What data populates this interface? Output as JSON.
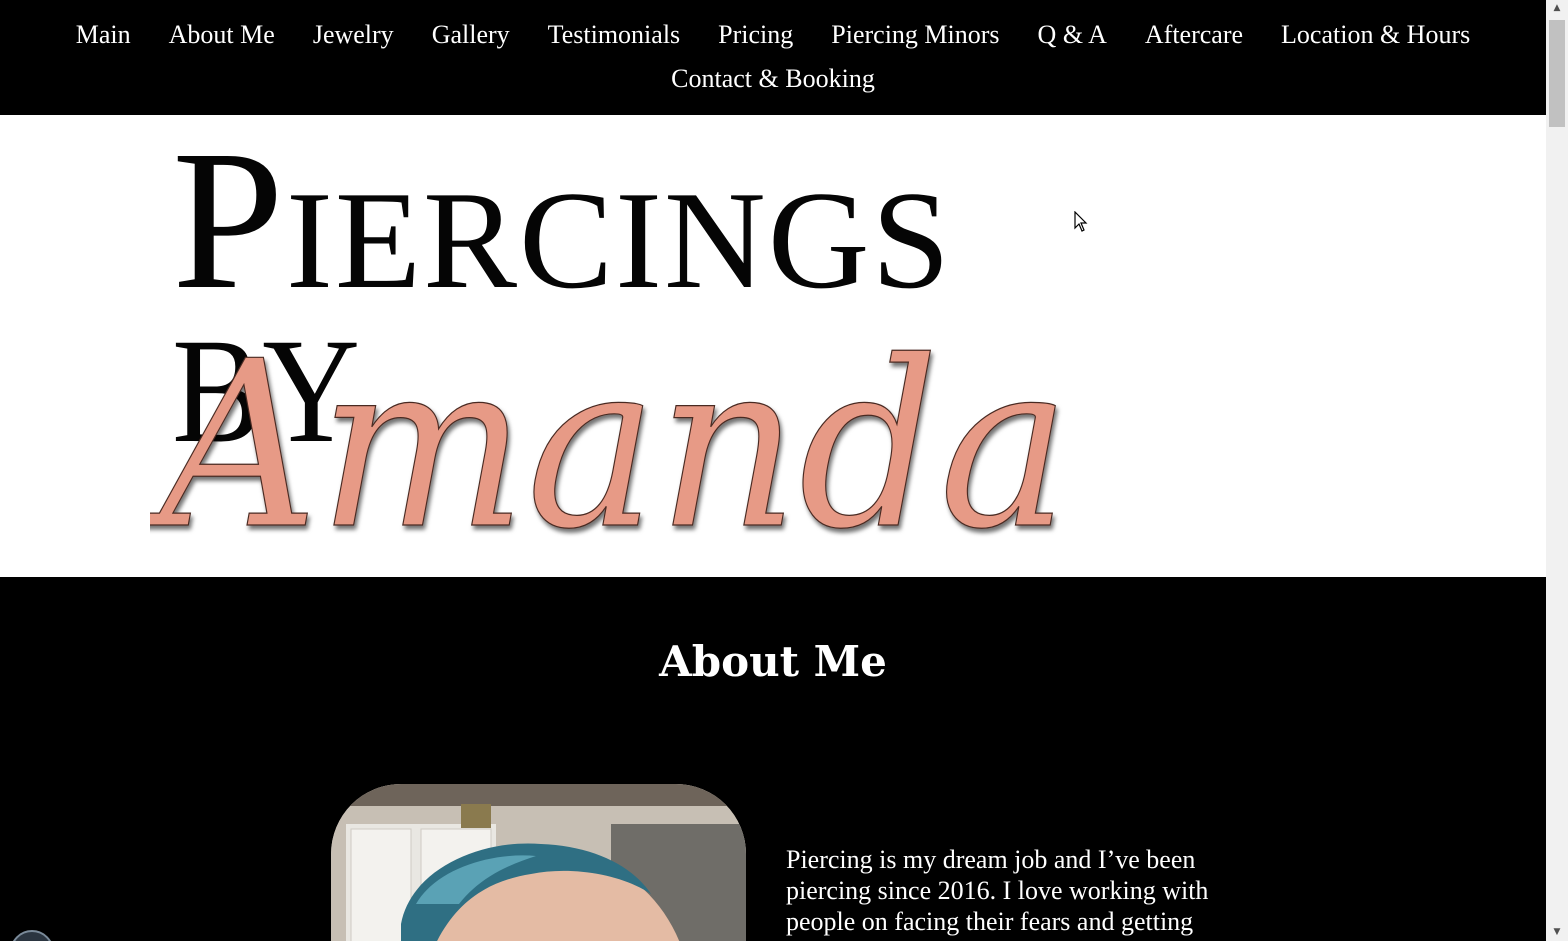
{
  "nav": {
    "row1": [
      "Main",
      "About Me",
      "Jewelry",
      "Gallery",
      "Testimonials",
      "Pricing",
      "Piercing Minors",
      "Q & A",
      "Aftercare",
      "Location & Hours"
    ],
    "row2": [
      "Contact & Booking"
    ]
  },
  "logo": {
    "line1": "Piercings",
    "line2": "BY",
    "script": "Amanda",
    "script_color": "#e79a86"
  },
  "about": {
    "title": "About Me",
    "text": "Piercing is my dream job and I’ve been piercing since 2016. I love working with people on facing their fears and getting"
  },
  "colors": {
    "nav_bg": "#000000",
    "hero_bg": "#ffffff",
    "accent": "#e79a86"
  }
}
